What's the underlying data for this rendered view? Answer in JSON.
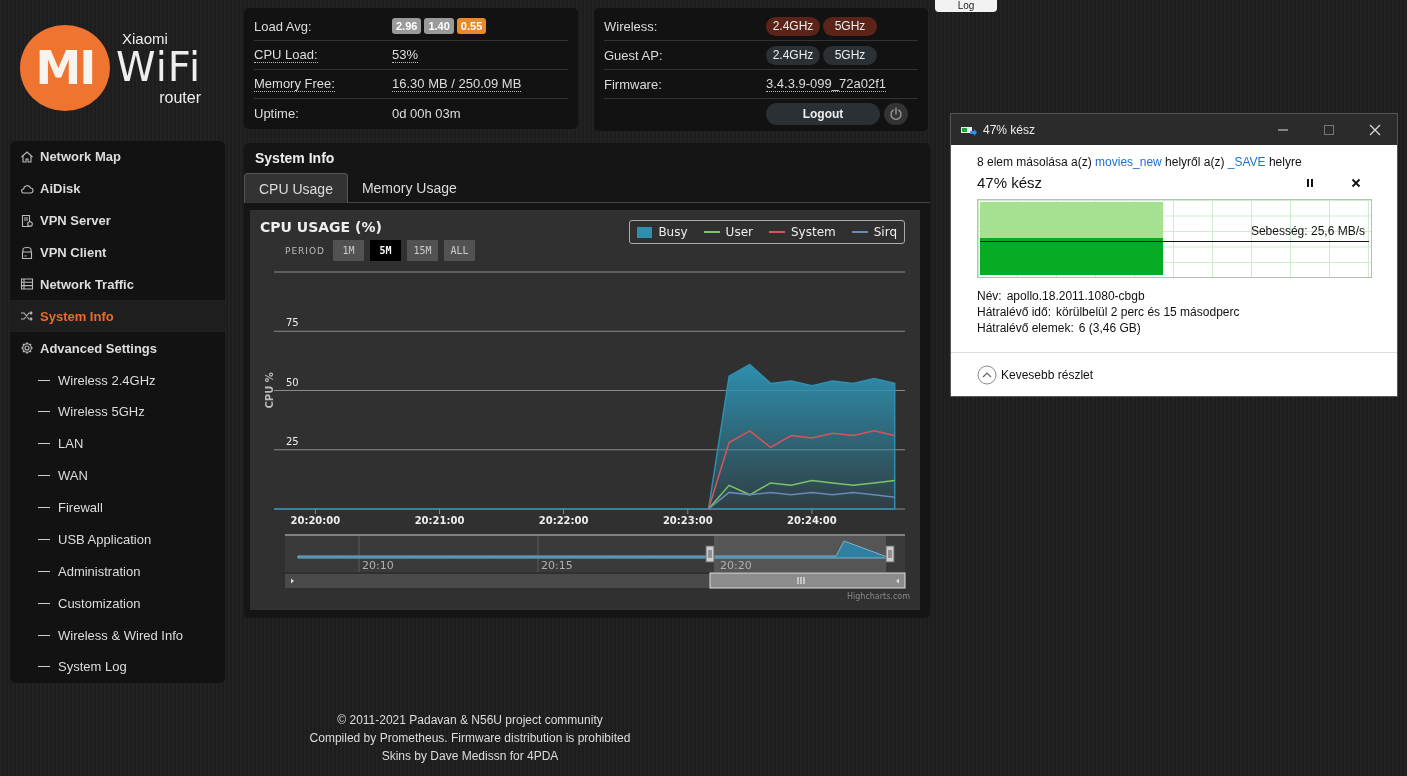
{
  "logo": {
    "mark": "MI",
    "line1": "Xiaomi",
    "line2": "WiFi",
    "line3": "router"
  },
  "log_button": "Log",
  "stats": [
    {
      "label": "Load Avg:",
      "badges": [
        {
          "text": "2.96",
          "color": "#9a9a9a"
        },
        {
          "text": "1.40",
          "color": "#9a9a9a"
        },
        {
          "text": "0.55",
          "color": "#e8892c"
        }
      ]
    },
    {
      "label": "CPU Load:",
      "value": "53%"
    },
    {
      "label": "Memory Free:",
      "value": "16.30 MB / 250.09 MB"
    },
    {
      "label": "Uptime:",
      "plain_value": "0d 00h 03m"
    }
  ],
  "radio": [
    {
      "label": "Wireless:",
      "bands": [
        {
          "label": "2.4GHz",
          "on": true
        },
        {
          "label": "5GHz",
          "on": true
        }
      ]
    },
    {
      "label": "Guest AP:",
      "bands": [
        {
          "label": "2.4GHz",
          "on": false
        },
        {
          "label": "5GHz",
          "on": false
        }
      ]
    },
    {
      "label": "Firmware:",
      "value": "3.4.3.9-099_72a02f1"
    }
  ],
  "logout": "Logout",
  "sidebar": {
    "items": [
      {
        "label": "Network Map",
        "selected": false
      },
      {
        "label": "AiDisk",
        "selected": false
      },
      {
        "label": "VPN Server",
        "selected": false
      },
      {
        "label": "VPN Client",
        "selected": false
      },
      {
        "label": "Network Traffic",
        "selected": false
      },
      {
        "label": "System Info",
        "selected": true
      },
      {
        "label": "Advanced Settings",
        "selected": false,
        "children": [
          {
            "label": "Wireless 2.4GHz",
            "selected": false
          },
          {
            "label": "Wireless 5GHz",
            "selected": false
          },
          {
            "label": "LAN",
            "selected": false
          },
          {
            "label": "WAN",
            "selected": false
          },
          {
            "label": "Firewall",
            "selected": false
          },
          {
            "label": "USB Application",
            "selected": false
          },
          {
            "label": "Administration",
            "selected": false
          },
          {
            "label": "Customization",
            "selected": false
          },
          {
            "label": "Wireless & Wired Info",
            "selected": false
          },
          {
            "label": "System Log",
            "selected": false
          }
        ]
      }
    ]
  },
  "system_info": {
    "title": "System Info",
    "tabs": [
      {
        "label": "CPU Usage",
        "selected": true
      },
      {
        "label": "Memory Usage",
        "selected": false
      }
    ],
    "period_label": "PERIOD",
    "periods": [
      {
        "label": "1M",
        "selected": false
      },
      {
        "label": "5M",
        "selected": true
      },
      {
        "label": "15M",
        "selected": false
      },
      {
        "label": "ALL",
        "selected": false
      }
    ],
    "navigator": {
      "labels": [
        "20:10",
        "20:15",
        "20:20"
      ]
    },
    "credit": "Highcharts.com",
    "chart_data": {
      "type": "line",
      "grid": true,
      "title": "CPU USAGE (%)",
      "ylabel": "CPU %",
      "categories": [
        null,
        null,
        "20:20:00",
        null,
        null,
        null,
        null,
        null,
        "20:21:00",
        null,
        null,
        null,
        null,
        null,
        "20:22:00",
        null,
        null,
        null,
        null,
        null,
        "20:23:00",
        null,
        null,
        null,
        null,
        null,
        "20:24:00",
        null,
        null,
        null,
        null
      ],
      "series": [
        {
          "name": "Busy",
          "type": "area",
          "color": "#2e8fae",
          "values": [
            0,
            0,
            0,
            0,
            0,
            0,
            0,
            0,
            0,
            0,
            0,
            0,
            0,
            0,
            0,
            0,
            0,
            0,
            0,
            0,
            0,
            0,
            56,
            61,
            53,
            54,
            52,
            54,
            53,
            55,
            53
          ]
        },
        {
          "name": "User",
          "color": "#7bc46a",
          "values": [
            null,
            null,
            null,
            null,
            null,
            null,
            null,
            null,
            null,
            null,
            null,
            null,
            null,
            null,
            null,
            null,
            null,
            null,
            null,
            null,
            null,
            0,
            10,
            6,
            11,
            10,
            12,
            11,
            10,
            11,
            12
          ]
        },
        {
          "name": "System",
          "color": "#d9545a",
          "values": [
            null,
            null,
            null,
            null,
            null,
            null,
            null,
            null,
            null,
            null,
            null,
            null,
            null,
            null,
            null,
            null,
            null,
            null,
            null,
            null,
            null,
            0,
            28,
            33,
            26,
            31,
            30,
            32,
            31,
            33,
            31
          ]
        },
        {
          "name": "Sirq",
          "color": "#6a8ab8",
          "values": [
            null,
            null,
            null,
            null,
            null,
            null,
            null,
            null,
            null,
            null,
            null,
            null,
            null,
            null,
            null,
            null,
            null,
            null,
            null,
            null,
            null,
            0,
            7,
            6,
            7,
            6,
            7,
            6,
            7,
            6,
            5
          ]
        }
      ],
      "ylim": [
        0,
        100
      ],
      "yticks": [
        25,
        50,
        75
      ]
    }
  },
  "footer": [
    "© 2011-2021 Padavan & N56U project community",
    "Compiled by Prometheus. Firmware distribution is prohibited",
    "Skins by Dave Medissn for 4PDA"
  ],
  "copy_dialog": {
    "title": "47% kész",
    "message": [
      {
        "kind": "text",
        "text": "8 elem másolása a(z) "
      },
      {
        "kind": "link",
        "text": "movies_new"
      },
      {
        "kind": "text",
        "text": " helyről a(z) "
      },
      {
        "kind": "link",
        "text": "_SAVE"
      },
      {
        "kind": "text",
        "text": " helyre"
      }
    ],
    "heading": "47% kész",
    "level": 0.47,
    "speed": "Sebesség: 25,6 MB/s",
    "details": [
      {
        "label": "Név:",
        "value": "apollo.18.2011.1080-cbgb"
      },
      {
        "label": "Hátralévő idő:",
        "value": "körülbelül 2 perc és 15 másodperc"
      },
      {
        "label": "Hátralévő elemek:",
        "value": "6 (3,46 GB)"
      }
    ],
    "toggle": "Kevesebb részlet"
  }
}
